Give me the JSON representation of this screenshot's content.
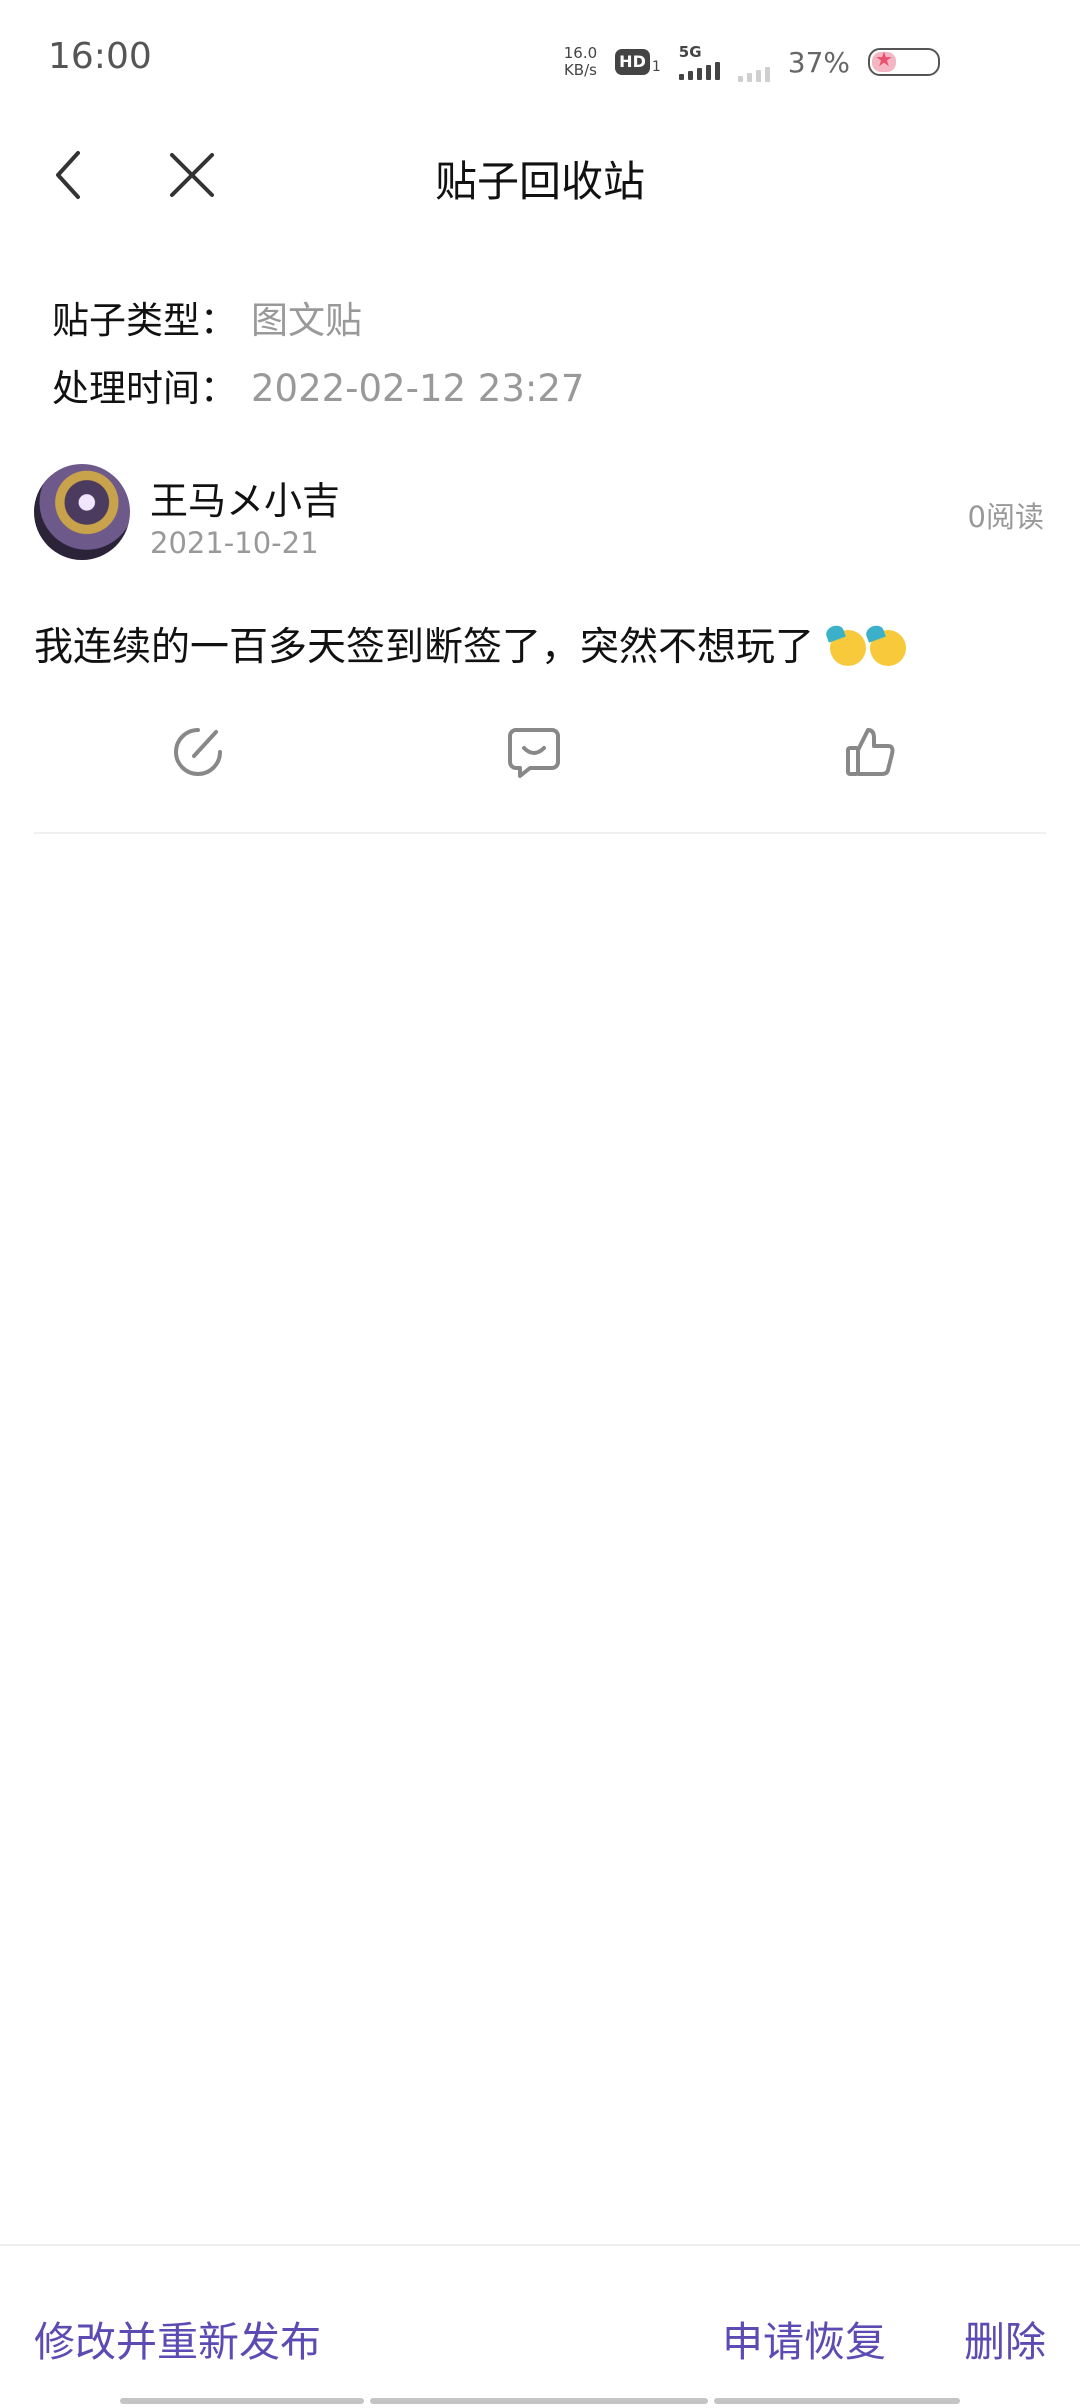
{
  "status_bar": {
    "time": "16:00",
    "net_speed_value": "16.0",
    "net_speed_unit": "KB/s",
    "hd_label": "HD",
    "hd_sub": "1",
    "network_label": "5G",
    "battery_percent": "37%"
  },
  "header": {
    "title": "贴子回收站"
  },
  "meta": {
    "type_label": "贴子类型：",
    "type_value": "图文贴",
    "time_label": "处理时间：",
    "time_value": "2022-02-12 23:27"
  },
  "post": {
    "author": "王马メ小吉",
    "date": "2021-10-21",
    "read_count": "0阅读",
    "content": "我连续的一百多天签到断签了，突然不想玩了"
  },
  "bottom_actions": {
    "edit_republish": "修改并重新发布",
    "request_restore": "申请恢复",
    "delete": "删除"
  },
  "colors": {
    "accent": "#5b4bb3",
    "secondary_text": "#999999"
  }
}
